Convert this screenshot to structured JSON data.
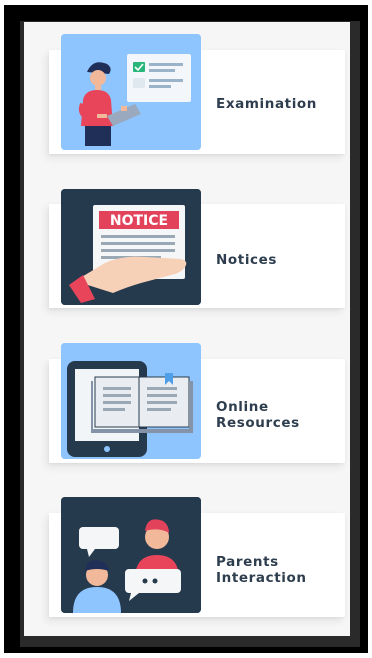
{
  "colors": {
    "light_tile": "#8ec5ff",
    "dark_tile": "#263a4e",
    "label_text": "#2e3e4e",
    "notice_red": "#e2425a"
  },
  "menu": {
    "items": [
      {
        "id": "examination",
        "label": "Examination",
        "icon": "student-laptop-exam-icon"
      },
      {
        "id": "notices",
        "label": "Notices",
        "icon": "notice-paper-icon",
        "badge_text": "NOTICE"
      },
      {
        "id": "online_resources",
        "label": "Online\nResources",
        "icon": "tablet-book-icon"
      },
      {
        "id": "parents_interaction",
        "label": "Parents\nInteraction",
        "icon": "people-chat-icon"
      }
    ]
  }
}
